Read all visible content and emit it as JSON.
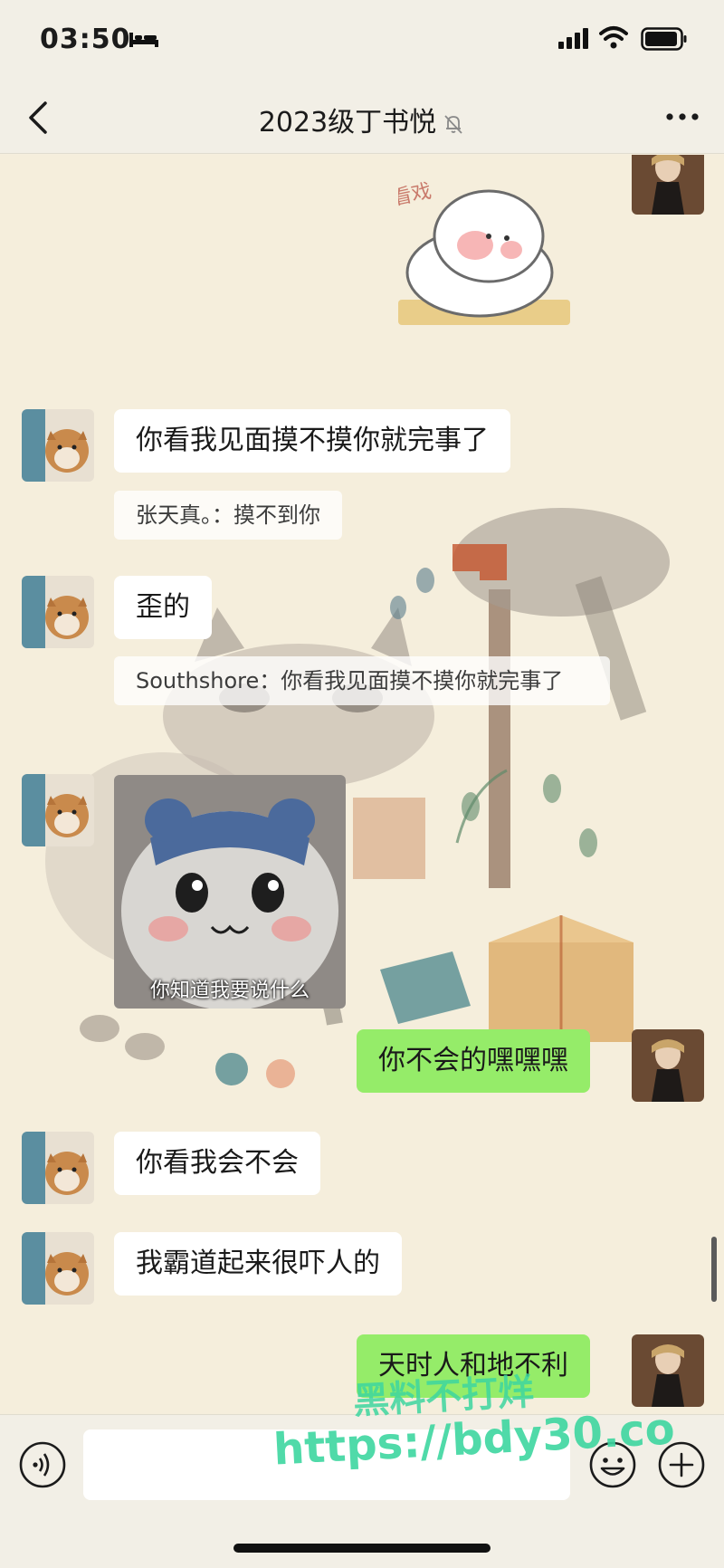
{
  "status_bar": {
    "time": "03:50",
    "icons": [
      "bed-icon",
      "signal-icon",
      "wifi-icon",
      "battery-icon"
    ]
  },
  "nav": {
    "title": "2023级丁书悦",
    "icons": [
      "back-chevron-icon",
      "mute-bell-icon",
      "more-dots-icon"
    ]
  },
  "messages": [
    {
      "id": 1,
      "side": "left",
      "type": "text",
      "text": "你看我见面摸不摸你就完事了"
    },
    {
      "id": 2,
      "side": "left",
      "type": "quote",
      "text": "张天真。：摸不到你"
    },
    {
      "id": 3,
      "side": "left",
      "type": "text",
      "text": "歪的"
    },
    {
      "id": 4,
      "side": "left",
      "type": "quote",
      "text": "Southshore：你看我见面摸不摸你就完事了"
    },
    {
      "id": 5,
      "side": "left",
      "type": "image",
      "caption": "你知道我要说什么"
    },
    {
      "id": 6,
      "side": "right",
      "type": "text",
      "text": "你不会的嘿嘿嘿"
    },
    {
      "id": 7,
      "side": "left",
      "type": "text",
      "text": "你看我会不会"
    },
    {
      "id": 8,
      "side": "left",
      "type": "text",
      "text": "我霸道起来很吓人的"
    },
    {
      "id": 9,
      "side": "right",
      "type": "text",
      "text": "天时人和地不利"
    }
  ],
  "sticker": {
    "caption": "看戏"
  },
  "input_bar": {
    "placeholder": "",
    "icons": [
      "voice-icon",
      "emoji-icon",
      "plus-icon"
    ]
  },
  "watermark": {
    "line1": "黑料不打烊",
    "line2": "https://bdy30.co"
  },
  "colors": {
    "bubble_self": "#95ec69",
    "bubble_other": "#ffffff",
    "chat_background": "#f5eedc",
    "bar_background": "#f2efe6",
    "watermark": "#3ed6a0"
  }
}
